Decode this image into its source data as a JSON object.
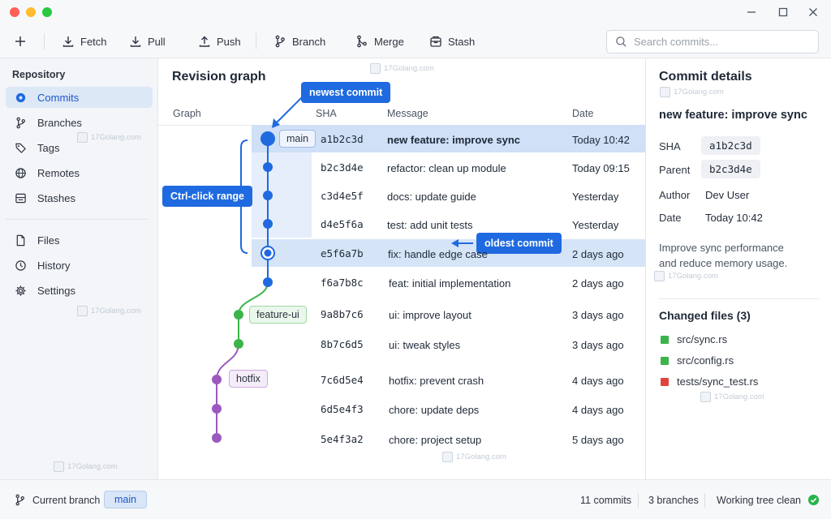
{
  "toolbar": {
    "fetch": "Fetch",
    "pull": "Pull",
    "push": "Push",
    "branch": "Branch",
    "merge": "Merge",
    "stash": "Stash",
    "search_placeholder": "Search commits..."
  },
  "sidebar": {
    "heading": "Repository",
    "items": [
      {
        "label": "Commits",
        "icon": "commit-icon"
      },
      {
        "label": "Branches",
        "icon": "branch-icon"
      },
      {
        "label": "Tags",
        "icon": "tag-icon"
      },
      {
        "label": "Remotes",
        "icon": "globe-icon"
      },
      {
        "label": "Stashes",
        "icon": "stash-icon"
      },
      {
        "label": "Files",
        "icon": "file-icon"
      },
      {
        "label": "History",
        "icon": "clock-icon"
      },
      {
        "label": "Settings",
        "icon": "gear-icon"
      }
    ]
  },
  "main": {
    "title": "Revision graph",
    "columns": {
      "graph": "Graph",
      "sha": "SHA",
      "message": "Message",
      "date": "Date"
    },
    "commits": [
      {
        "sha": "a1b2c3d",
        "message": "new feature: improve sync",
        "date": "Today 10:42",
        "branch": "main"
      },
      {
        "sha": "b2c3d4e",
        "message": "refactor: clean up module",
        "date": "Today 09:15",
        "branch": "main"
      },
      {
        "sha": "c3d4e5f",
        "message": "docs: update guide",
        "date": "Yesterday",
        "branch": "main"
      },
      {
        "sha": "d4e5f6a",
        "message": "test: add unit tests",
        "date": "Yesterday",
        "branch": "main"
      },
      {
        "sha": "e5f6a7b",
        "message": "fix: handle edge case",
        "date": "2 days ago",
        "branch": "main"
      },
      {
        "sha": "f6a7b8c",
        "message": "feat: initial implementation",
        "date": "2 days ago",
        "branch": "main"
      },
      {
        "sha": "9a8b7c6",
        "message": "ui: improve layout",
        "date": "3 days ago",
        "branch": "feature-ui"
      },
      {
        "sha": "8b7c6d5",
        "message": "ui: tweak styles",
        "date": "3 days ago",
        "branch": "feature-ui"
      },
      {
        "sha": "7c6d5e4",
        "message": "hotfix: prevent crash",
        "date": "4 days ago",
        "branch": "hotfix"
      },
      {
        "sha": "6d5e4f3",
        "message": "chore: update deps",
        "date": "4 days ago",
        "branch": "hotfix"
      },
      {
        "sha": "5e4f3a2",
        "message": "chore: project setup",
        "date": "5 days ago",
        "branch": "hotfix"
      }
    ],
    "branch_tags": {
      "main": "main",
      "feature": "feature-ui",
      "hotfix": "hotfix"
    },
    "callouts": {
      "newest": "newest commit",
      "range": "Ctrl-click range",
      "oldest": "oldest commit"
    },
    "colors": {
      "main": "#1f6ae0",
      "feature": "#3cb44b",
      "hotfix": "#9b59c0",
      "highlight": "#d6e4f8"
    }
  },
  "details": {
    "title": "Commit details",
    "message": "new feature: improve sync",
    "sha_label": "SHA",
    "sha": "a1b2c3d",
    "parent_label": "Parent",
    "parent": "b2c3d4e",
    "author_label": "Author",
    "author": "Dev User",
    "date_label": "Date",
    "date": "Today 10:42",
    "description_line1": "Improve sync performance",
    "description_line2": "and reduce memory usage.",
    "files_heading": "Changed files (3)",
    "files": [
      {
        "path": "src/sync.rs",
        "status_color": "#3cb44b"
      },
      {
        "path": "src/config.rs",
        "status_color": "#3cb44b"
      },
      {
        "path": "tests/sync_test.rs",
        "status_color": "#e0443e"
      }
    ]
  },
  "status": {
    "current_branch_label": "Current branch",
    "current_branch": "main",
    "commits": "11 commits",
    "branches": "3 branches",
    "tree_state": "Working tree clean"
  },
  "watermark": "17Golang.com"
}
